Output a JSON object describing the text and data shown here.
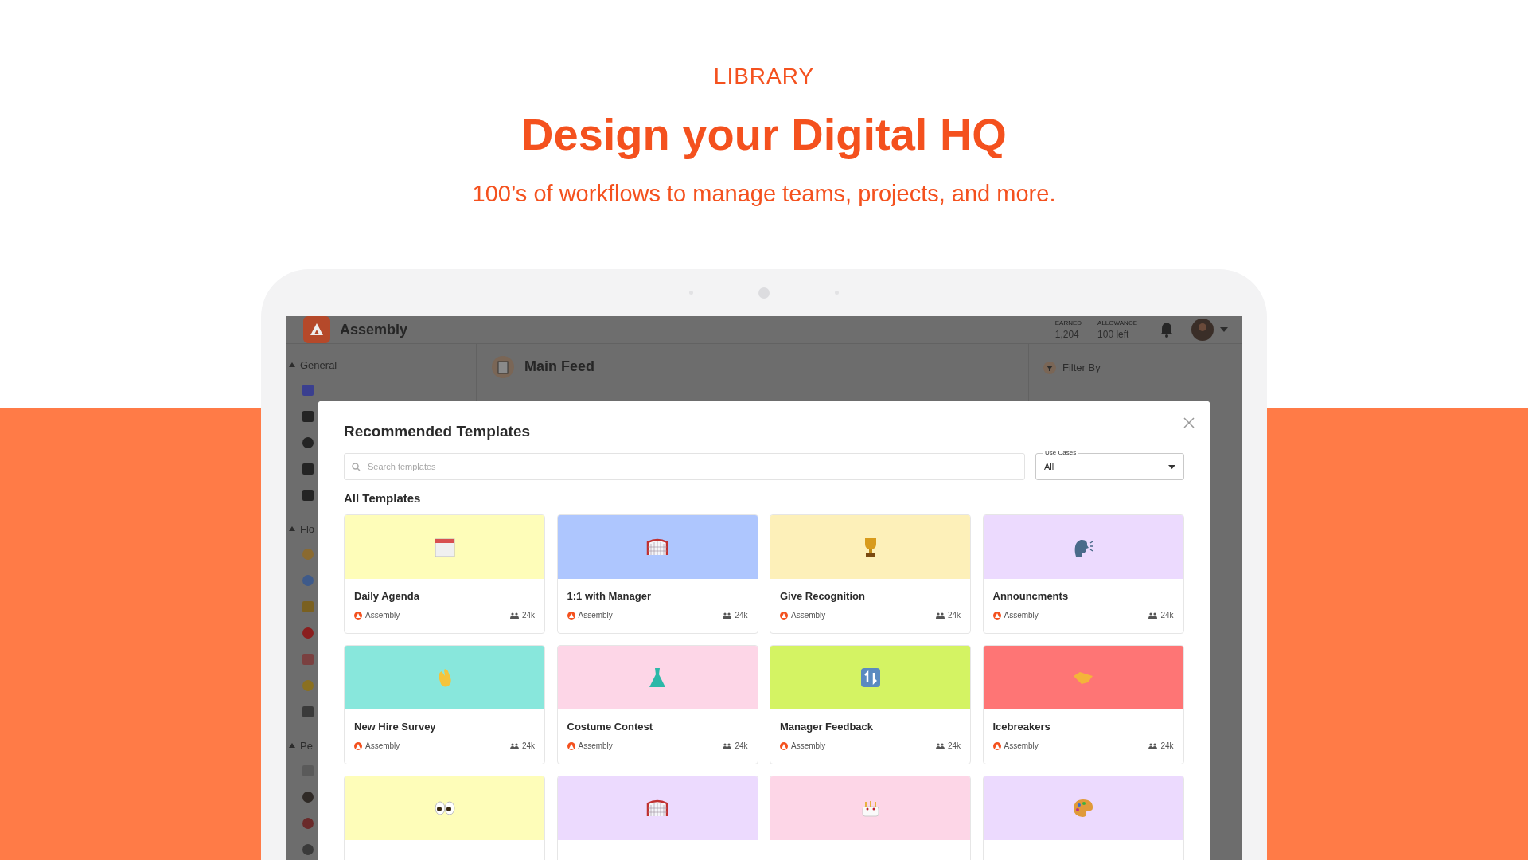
{
  "hero": {
    "eyebrow": "LIBRARY",
    "title": "Design your Digital HQ",
    "subtitle": "100’s of workflows to manage teams, projects, and more."
  },
  "app": {
    "brand": "Assembly",
    "stats": [
      {
        "label": "EARNED",
        "value": "1,204"
      },
      {
        "label": "ALLOWANCE",
        "value": "100 left"
      }
    ],
    "sidebar": {
      "sections": [
        {
          "label": "General"
        },
        {
          "label": "Flo"
        },
        {
          "label": "Pe"
        }
      ]
    },
    "main_feed": {
      "title": "Main Feed"
    },
    "filter_panel": {
      "label": "Filter By"
    }
  },
  "modal": {
    "title": "Recommended Templates",
    "search": {
      "placeholder": "Search templates"
    },
    "use_cases": {
      "label": "Use Cases",
      "value": "All"
    },
    "section_title": "All Templates",
    "templates": [
      {
        "title": "Daily Agenda",
        "author": "Assembly",
        "count": "24k",
        "color": "#fefdb9"
      },
      {
        "title": "1:1 with Manager",
        "author": "Assembly",
        "count": "24k",
        "color": "#aec6fe"
      },
      {
        "title": "Give Recognition",
        "author": "Assembly",
        "count": "24k",
        "color": "#fdf0b9"
      },
      {
        "title": "Announcments",
        "author": "Assembly",
        "count": "24k",
        "color": "#ecdafe"
      },
      {
        "title": "New Hire Survey",
        "author": "Assembly",
        "count": "24k",
        "color": "#88e7dc"
      },
      {
        "title": "Costume Contest",
        "author": "Assembly",
        "count": "24k",
        "color": "#fdd6e7"
      },
      {
        "title": "Manager Feedback",
        "author": "Assembly",
        "count": "24k",
        "color": "#d4f363"
      },
      {
        "title": "Icebreakers",
        "author": "Assembly",
        "count": "24k",
        "color": "#fe7575"
      },
      {
        "color": "#fefdb9"
      },
      {
        "color": "#ecdafe"
      },
      {
        "color": "#fdd6e7"
      },
      {
        "color": "#ecdafe"
      }
    ]
  }
}
